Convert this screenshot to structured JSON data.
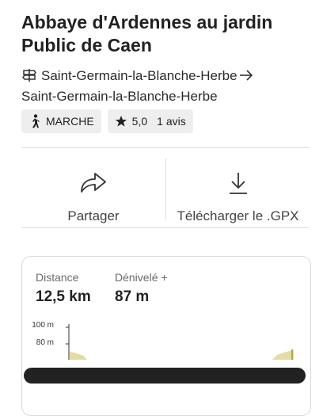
{
  "title_line1": "Abbaye d'Ardennes au jardin",
  "title_line2": "Public de Caen",
  "route": {
    "start": "Saint-Germain-la-Blanche-Herbe",
    "end": "Saint-Germain-la-Blanche-Herbe",
    "sign_icon": "signpost-icon",
    "arrow_icon": "arrow-right-icon"
  },
  "chips": {
    "activity": "MARCHE",
    "activity_icon": "walking-person-icon",
    "rating": "5,0",
    "rating_icon": "star-icon",
    "reviews": "1 avis"
  },
  "actions": {
    "share_label": "Partager",
    "share_icon": "share-arrow-icon",
    "download_label": "Télécharger le .GPX",
    "download_icon": "download-icon"
  },
  "stats": {
    "distance_label": "Distance",
    "distance_value": "12,5 km",
    "elevation_label": "Dénivelé +",
    "elevation_value": "87 m"
  },
  "chart_data": {
    "type": "area",
    "y_ticks": [
      "100 m",
      "80 m"
    ],
    "ylabel": "",
    "xlabel": "",
    "fill_color": "#e0d9a0",
    "line_color": "#b8a24a"
  }
}
